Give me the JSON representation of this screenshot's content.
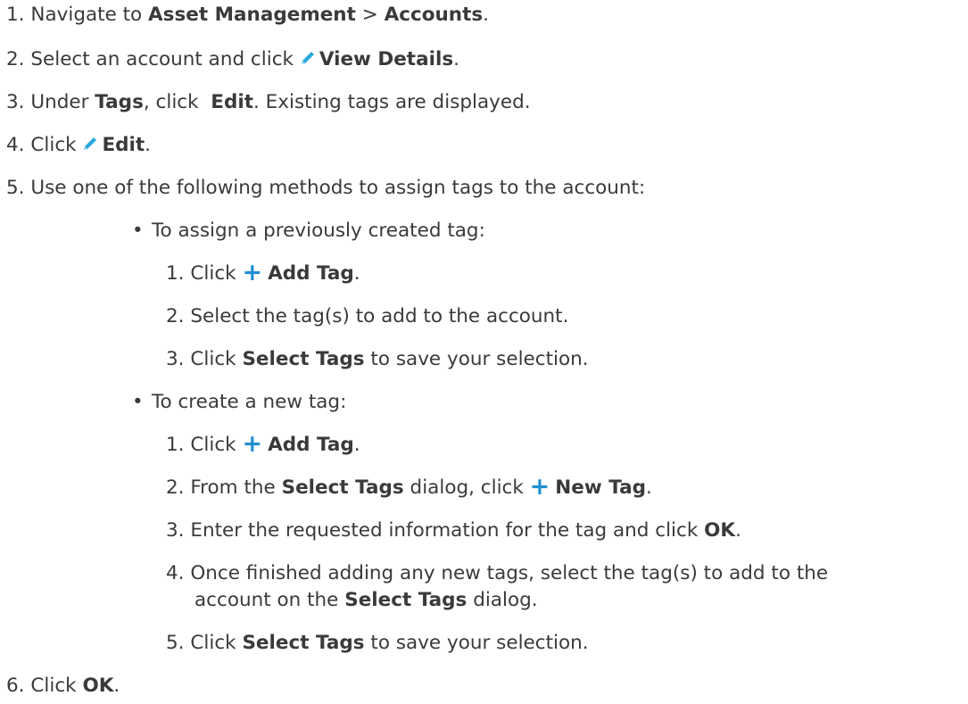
{
  "steps": {
    "s1": {
      "num": "1.",
      "t1": "Navigate to ",
      "b1": "Asset Management",
      "t2": " > ",
      "b2": "Accounts",
      "t3": "."
    },
    "s2": {
      "num": "2.",
      "t1": "Select an account and click ",
      "icon": "pencil-icon",
      "b1": "View Details",
      "t2": "."
    },
    "s3": {
      "num": "3.",
      "t1": "Under ",
      "b1": "Tags",
      "t2": ", click  ",
      "b2": "Edit",
      "t3": ". Existing tags are displayed."
    },
    "s4": {
      "num": "4.",
      "t1": "Click ",
      "icon": "pencil-icon",
      "b1": "Edit",
      "t2": "."
    },
    "s5": {
      "num": "5.",
      "t1": "Use one of the following methods to assign tags to the account:"
    },
    "bulletA": {
      "bullet": "•",
      "t1": "To assign a previously created tag:"
    },
    "a1": {
      "num": "1.",
      "t1": "Click ",
      "icon": "plus-icon",
      "b1": "Add Tag",
      "t2": "."
    },
    "a2": {
      "num": "2.",
      "t1": "Select the tag(s) to add to the account."
    },
    "a3": {
      "num": "3.",
      "t1": "Click ",
      "b1": "Select Tags",
      "t2": " to save your selection."
    },
    "bulletB": {
      "bullet": "•",
      "t1": "To create a new tag:"
    },
    "b1": {
      "num": "1.",
      "t1": "Click ",
      "icon": "plus-icon",
      "b1": "Add Tag",
      "t2": "."
    },
    "b2": {
      "num": "2.",
      "t1": "From the ",
      "b1": "Select Tags",
      "t2": " dialog, click ",
      "icon": "plus-icon",
      "b2": "New Tag",
      "t3": "."
    },
    "b3": {
      "num": "3.",
      "t1": "Enter the requested information for the tag and click ",
      "b1": "OK",
      "t2": "."
    },
    "b4": {
      "num": "4.",
      "t1": "Once finished adding any new tags, select the tag(s) to add to the",
      "t2": "account on the ",
      "b1": "Select Tags",
      "t3": " dialog."
    },
    "b5": {
      "num": "5.",
      "t1": "Click ",
      "b1": "Select Tags",
      "t2": " to save your selection."
    },
    "s6": {
      "num": "6.",
      "t1": "Click ",
      "b1": "OK",
      "t2": "."
    }
  },
  "icons": {
    "plus_glyph": "+",
    "plus_color": "#1f8fd1",
    "pencil_color": "#2aa8e0"
  }
}
